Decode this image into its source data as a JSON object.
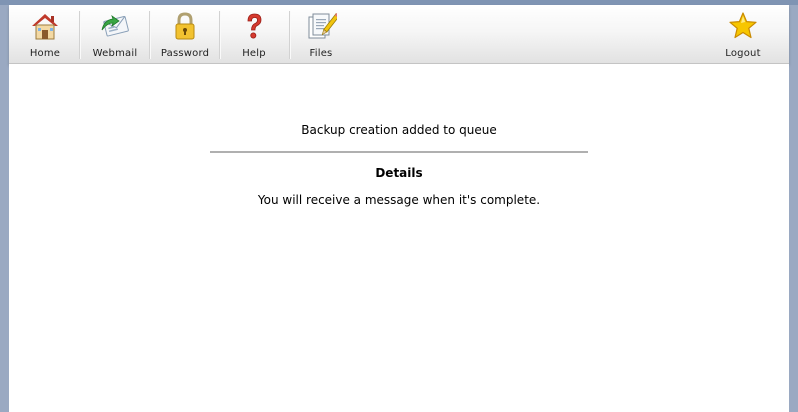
{
  "toolbar": {
    "items": [
      {
        "label": "Home",
        "icon": "home-icon"
      },
      {
        "label": "Webmail",
        "icon": "webmail-icon"
      },
      {
        "label": "Password",
        "icon": "lock-icon"
      },
      {
        "label": "Help",
        "icon": "question-icon"
      },
      {
        "label": "Files",
        "icon": "files-icon"
      }
    ],
    "logout": {
      "label": "Logout",
      "icon": "star-icon"
    }
  },
  "message": {
    "main": "Backup creation added to queue",
    "details_heading": "Details",
    "details_text": "You will receive a message when it's complete."
  },
  "colors": {
    "frame": "#9aa9c2",
    "divider": "#b0b0b0"
  }
}
